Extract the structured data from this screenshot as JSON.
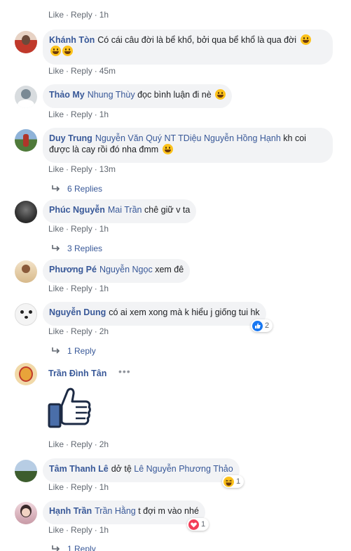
{
  "top_actions": {
    "like": "Like",
    "reply": "Reply",
    "time": "1h"
  },
  "comments": [
    {
      "author": "Khánh Tòn",
      "tag": "",
      "text": "Có cái câu đời là bể khổ, bởi qua bể khổ là qua đời",
      "like": "Like",
      "reply": "Reply",
      "time": "45m"
    },
    {
      "author": "Thảo My",
      "tag": "Nhung Thùy",
      "text": "đọc bình luận đi nè",
      "like": "Like",
      "reply": "Reply",
      "time": "1h"
    },
    {
      "author": "Duy Trung",
      "tag": "Nguyễn Văn Quý NT TDiệu Nguyễn Hồng Hạnh",
      "text": "kh coi",
      "text2": "được là cay rồi đó nha đmm",
      "like": "Like",
      "reply": "Reply",
      "time": "13m",
      "replies": "6 Replies"
    },
    {
      "author": "Phúc Nguyễn",
      "tag": "Mai Trần",
      "text": "chê giữ v ta",
      "like": "Like",
      "reply": "Reply",
      "time": "1h",
      "replies": "3 Replies"
    },
    {
      "author": "Phương Pé",
      "tag": "Nguyễn Ngọc",
      "text": "xem đê",
      "like": "Like",
      "reply": "Reply",
      "time": "1h"
    },
    {
      "author": "Nguyễn Dung",
      "tag": "",
      "text": "có ai xem xong mà k hiểu j giống tui hk",
      "like": "Like",
      "reply": "Reply",
      "time": "2h",
      "replies": "1 Reply",
      "reaction_count": "2"
    },
    {
      "author": "Trần Đình Tân",
      "tag": "",
      "text": "",
      "like": "Like",
      "reply": "Reply",
      "time": "2h"
    },
    {
      "author": "Tâm Thanh Lê",
      "tag": "Lê Nguyễn Phương Thảo",
      "text": "dở tệ",
      "like": "Like",
      "reply": "Reply",
      "time": "1h",
      "reaction_count": "1"
    },
    {
      "author": "Hạnh Trần",
      "tag": "Trần Hằng",
      "text": "t đợi m vào nhé",
      "like": "Like",
      "reply": "Reply",
      "time": "1h",
      "reaction_count": "1",
      "replies": "1 Reply"
    }
  ],
  "colors": {
    "link": "#385898",
    "bubble": "#f2f3f5",
    "meta": "#606770",
    "like_blue": "#1877f2",
    "love_red": "#f33e58",
    "haha_yellow": "#fcc21b"
  },
  "icons": {
    "like_sticker": "thumbs-up-icon",
    "reply_arrow": "reply-arrow-icon",
    "more": "more-options-icon"
  }
}
